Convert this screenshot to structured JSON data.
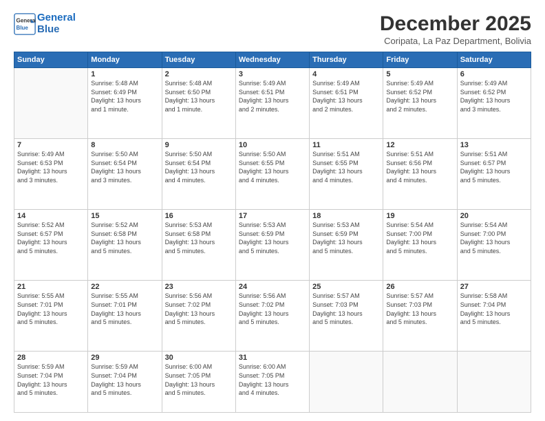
{
  "header": {
    "logo_line1": "General",
    "logo_line2": "Blue",
    "title": "December 2025",
    "location": "Coripata, La Paz Department, Bolivia"
  },
  "weekdays": [
    "Sunday",
    "Monday",
    "Tuesday",
    "Wednesday",
    "Thursday",
    "Friday",
    "Saturday"
  ],
  "weeks": [
    [
      {
        "day": "",
        "info": ""
      },
      {
        "day": "1",
        "info": "Sunrise: 5:48 AM\nSunset: 6:49 PM\nDaylight: 13 hours\nand 1 minute."
      },
      {
        "day": "2",
        "info": "Sunrise: 5:48 AM\nSunset: 6:50 PM\nDaylight: 13 hours\nand 1 minute."
      },
      {
        "day": "3",
        "info": "Sunrise: 5:49 AM\nSunset: 6:51 PM\nDaylight: 13 hours\nand 2 minutes."
      },
      {
        "day": "4",
        "info": "Sunrise: 5:49 AM\nSunset: 6:51 PM\nDaylight: 13 hours\nand 2 minutes."
      },
      {
        "day": "5",
        "info": "Sunrise: 5:49 AM\nSunset: 6:52 PM\nDaylight: 13 hours\nand 2 minutes."
      },
      {
        "day": "6",
        "info": "Sunrise: 5:49 AM\nSunset: 6:52 PM\nDaylight: 13 hours\nand 3 minutes."
      }
    ],
    [
      {
        "day": "7",
        "info": "Sunrise: 5:49 AM\nSunset: 6:53 PM\nDaylight: 13 hours\nand 3 minutes."
      },
      {
        "day": "8",
        "info": "Sunrise: 5:50 AM\nSunset: 6:54 PM\nDaylight: 13 hours\nand 3 minutes."
      },
      {
        "day": "9",
        "info": "Sunrise: 5:50 AM\nSunset: 6:54 PM\nDaylight: 13 hours\nand 4 minutes."
      },
      {
        "day": "10",
        "info": "Sunrise: 5:50 AM\nSunset: 6:55 PM\nDaylight: 13 hours\nand 4 minutes."
      },
      {
        "day": "11",
        "info": "Sunrise: 5:51 AM\nSunset: 6:55 PM\nDaylight: 13 hours\nand 4 minutes."
      },
      {
        "day": "12",
        "info": "Sunrise: 5:51 AM\nSunset: 6:56 PM\nDaylight: 13 hours\nand 4 minutes."
      },
      {
        "day": "13",
        "info": "Sunrise: 5:51 AM\nSunset: 6:57 PM\nDaylight: 13 hours\nand 5 minutes."
      }
    ],
    [
      {
        "day": "14",
        "info": "Sunrise: 5:52 AM\nSunset: 6:57 PM\nDaylight: 13 hours\nand 5 minutes."
      },
      {
        "day": "15",
        "info": "Sunrise: 5:52 AM\nSunset: 6:58 PM\nDaylight: 13 hours\nand 5 minutes."
      },
      {
        "day": "16",
        "info": "Sunrise: 5:53 AM\nSunset: 6:58 PM\nDaylight: 13 hours\nand 5 minutes."
      },
      {
        "day": "17",
        "info": "Sunrise: 5:53 AM\nSunset: 6:59 PM\nDaylight: 13 hours\nand 5 minutes."
      },
      {
        "day": "18",
        "info": "Sunrise: 5:53 AM\nSunset: 6:59 PM\nDaylight: 13 hours\nand 5 minutes."
      },
      {
        "day": "19",
        "info": "Sunrise: 5:54 AM\nSunset: 7:00 PM\nDaylight: 13 hours\nand 5 minutes."
      },
      {
        "day": "20",
        "info": "Sunrise: 5:54 AM\nSunset: 7:00 PM\nDaylight: 13 hours\nand 5 minutes."
      }
    ],
    [
      {
        "day": "21",
        "info": "Sunrise: 5:55 AM\nSunset: 7:01 PM\nDaylight: 13 hours\nand 5 minutes."
      },
      {
        "day": "22",
        "info": "Sunrise: 5:55 AM\nSunset: 7:01 PM\nDaylight: 13 hours\nand 5 minutes."
      },
      {
        "day": "23",
        "info": "Sunrise: 5:56 AM\nSunset: 7:02 PM\nDaylight: 13 hours\nand 5 minutes."
      },
      {
        "day": "24",
        "info": "Sunrise: 5:56 AM\nSunset: 7:02 PM\nDaylight: 13 hours\nand 5 minutes."
      },
      {
        "day": "25",
        "info": "Sunrise: 5:57 AM\nSunset: 7:03 PM\nDaylight: 13 hours\nand 5 minutes."
      },
      {
        "day": "26",
        "info": "Sunrise: 5:57 AM\nSunset: 7:03 PM\nDaylight: 13 hours\nand 5 minutes."
      },
      {
        "day": "27",
        "info": "Sunrise: 5:58 AM\nSunset: 7:04 PM\nDaylight: 13 hours\nand 5 minutes."
      }
    ],
    [
      {
        "day": "28",
        "info": "Sunrise: 5:59 AM\nSunset: 7:04 PM\nDaylight: 13 hours\nand 5 minutes."
      },
      {
        "day": "29",
        "info": "Sunrise: 5:59 AM\nSunset: 7:04 PM\nDaylight: 13 hours\nand 5 minutes."
      },
      {
        "day": "30",
        "info": "Sunrise: 6:00 AM\nSunset: 7:05 PM\nDaylight: 13 hours\nand 5 minutes."
      },
      {
        "day": "31",
        "info": "Sunrise: 6:00 AM\nSunset: 7:05 PM\nDaylight: 13 hours\nand 4 minutes."
      },
      {
        "day": "",
        "info": ""
      },
      {
        "day": "",
        "info": ""
      },
      {
        "day": "",
        "info": ""
      }
    ]
  ]
}
